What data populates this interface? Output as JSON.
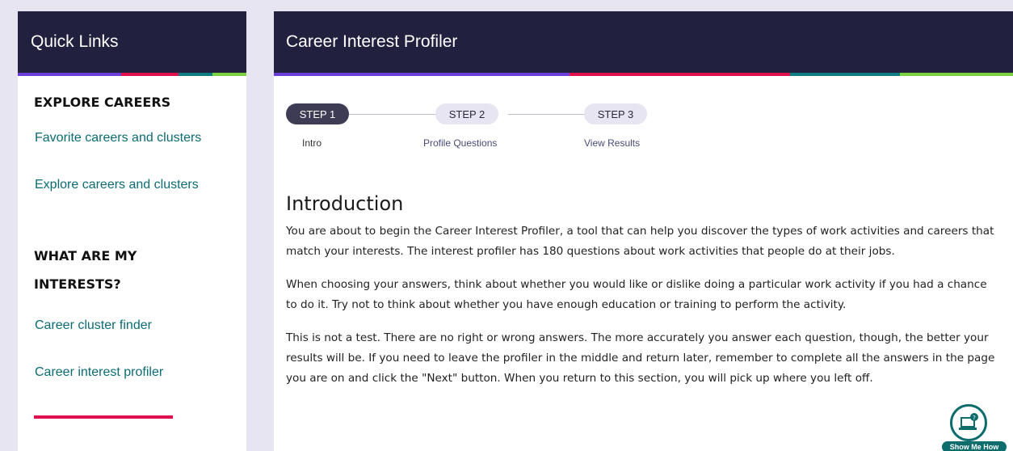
{
  "colors": {
    "header_bg": "#22203f",
    "link": "#0b6b73",
    "accent_pink": "#e0104f",
    "accent_purple": "#6a3dd4",
    "accent_teal": "#0e7c82",
    "accent_green": "#7ad03e"
  },
  "sidebar": {
    "title": "Quick Links",
    "section1_title": "EXPLORE CAREERS",
    "section1_links": [
      "Favorite careers and clusters",
      "Explore careers and clusters"
    ],
    "section2_title_line1": "WHAT ARE MY",
    "section2_title_line2": "INTERESTS?",
    "section2_links": [
      "Career cluster finder",
      "Career interest profiler"
    ],
    "active_link": "Career interest profiler"
  },
  "main": {
    "title": "Career Interest Profiler",
    "steps": [
      {
        "label": "STEP 1",
        "caption": "Intro",
        "active": true
      },
      {
        "label": "STEP 2",
        "caption": "Profile Questions",
        "active": false
      },
      {
        "label": "STEP 3",
        "caption": "View Results",
        "active": false
      }
    ],
    "heading": "Introduction",
    "paragraphs": [
      "You are about to begin the Career Interest Profiler, a tool that can help you discover the types of work activities and careers that match your interests. The interest profiler has 180 questions about work activities that people do at their jobs.",
      "When choosing your answers, think about whether you would like or dislike doing a particular work activity if you had a chance to do it. Try not to think about whether you have enough education or training to perform the activity.",
      "This is not a test. There are no right or wrong answers. The more accurately you answer each question, though, the better your results will be. If you need to leave the profiler in the middle and return later, remember to complete all the answers in the page you are on and click the \"Next\" button. When you return to this section, you will pick up where you left off."
    ]
  },
  "help_widget": {
    "label": "Show Me How",
    "icon": "laptop-help-icon"
  }
}
